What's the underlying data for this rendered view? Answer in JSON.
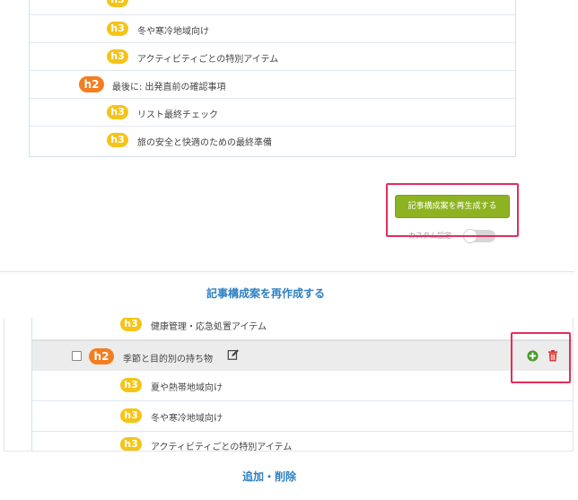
{
  "top_outline": {
    "rows": [
      {
        "level": "h3",
        "text": "冬や寒冷地域向け"
      },
      {
        "level": "h3",
        "text": "アクティビティごとの特別アイテム"
      },
      {
        "level": "h2",
        "text": "最後に: 出発直前の確認事項"
      },
      {
        "level": "h3",
        "text": "リスト最終チェック"
      },
      {
        "level": "h3",
        "text": "旅の安全と快適のための最終準備"
      }
    ]
  },
  "regenerate_button_label": "記事構成案を再生成する",
  "custom_setting_label": "カスタム設定",
  "custom_setting_enabled": false,
  "caption_recreate": "記事構成案を再作成する",
  "bottom_outline": {
    "rows": [
      {
        "level": "h3",
        "text": "健康管理・応急処置アイテム"
      },
      {
        "level": "h2",
        "text": "季節と目的別の持ち物"
      },
      {
        "level": "h3",
        "text": "夏や熱帯地域向け"
      },
      {
        "level": "h3",
        "text": "冬や寒冷地域向け"
      },
      {
        "level": "h3",
        "text": "アクティビティごとの特別アイテム"
      }
    ]
  },
  "caption_add_delete": "追加・削除",
  "colors": {
    "h2_badge": "#f47e1f",
    "h3_badge": "#f5c419",
    "regen_button": "#8db322",
    "highlight": "#e52d5a",
    "caption": "#2d7fc1",
    "add_icon": "#4c9a2a",
    "trash_icon": "#d9312b"
  }
}
